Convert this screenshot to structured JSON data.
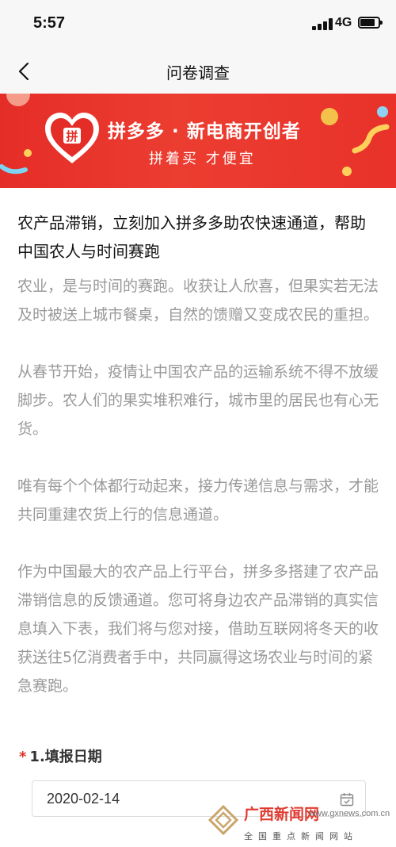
{
  "status_bar": {
    "time": "5:57",
    "network": "4G"
  },
  "nav": {
    "title": "问卷调查"
  },
  "banner": {
    "slogan": "拼多多 · 新电商开创者",
    "sub": "拼着买 才便宜",
    "logo_text": "拼"
  },
  "article": {
    "title": "农产品滞销，立刻加入拼多多助农快速通道，帮助中国农人与时间赛跑",
    "paragraphs": [
      "农业，是与时间的赛跑。收获让人欣喜，但果实若无法及时被送上城市餐桌，自然的馈赠又变成农民的重担。",
      "从春节开始，疫情让中国农产品的运输系统不得不放缓脚步。农人们的果实堆积难行，城市里的居民也有心无货。",
      "唯有每个个体都行动起来，接力传递信息与需求，才能共同重建农货上行的信息通道。",
      "作为中国最大的农产品上行平台，拼多多搭建了农产品滞销信息的反馈通道。您可将身边农产品滞销的真实信息填入下表，我们将与您对接，借助互联网将冬天的收获送往5亿消费者手中，共同赢得这场农业与时间的紧急赛跑。"
    ]
  },
  "form": {
    "q1": {
      "required_mark": "*",
      "label": "1.填报日期",
      "value": "2020-02-14"
    }
  },
  "watermark": {
    "name": "广西新闻网",
    "url": "www.gxnews.com.cn",
    "tag": "全国重点新闻网站"
  },
  "colors": {
    "brand_red": "#e42d27",
    "required": "#e02e24",
    "body_text": "#999999"
  },
  "icons": {
    "back": "chevron-left-icon",
    "calendar": "calendar-icon"
  }
}
